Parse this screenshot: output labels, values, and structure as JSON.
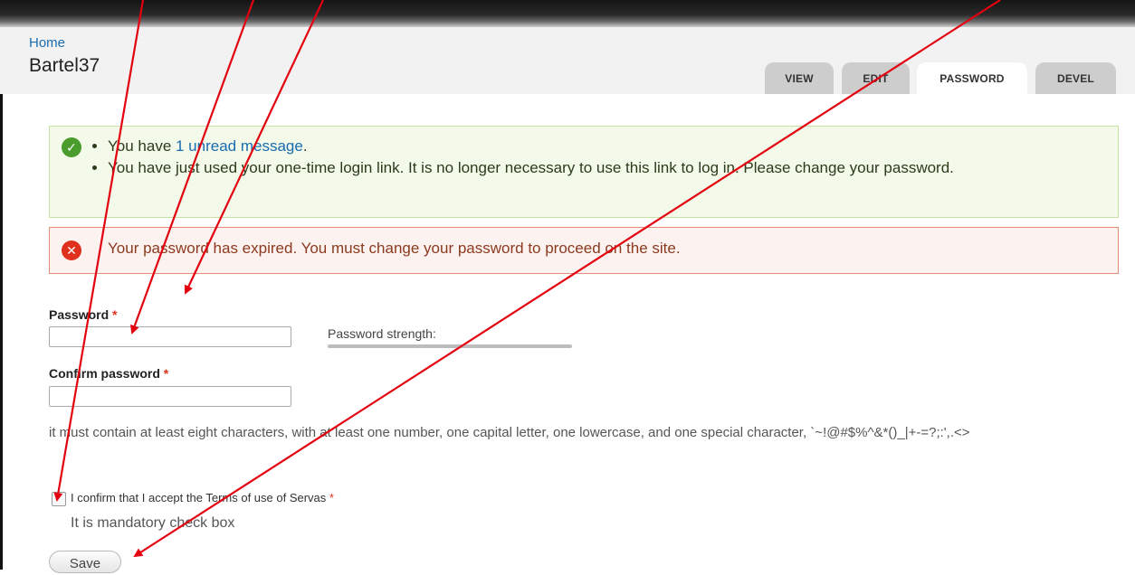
{
  "breadcrumb": "Home",
  "page_title": "Bartel37",
  "tabs": [
    {
      "label": "VIEW",
      "active": false
    },
    {
      "label": "EDIT",
      "active": false
    },
    {
      "label": "PASSWORD",
      "active": true
    },
    {
      "label": "DEVEL",
      "active": false
    }
  ],
  "status_messages": {
    "item1_prefix": "You have ",
    "item1_link": "1 unread message",
    "item1_suffix": ".",
    "item2": "You have just used your one-time login link. It is no longer necessary to use this link to log in. Please change your password.",
    "icon": "check-icon",
    "color": "#4a9c2d"
  },
  "error_message": {
    "text": "Your password has expired. You must change your password to proceed on the site.",
    "icon": "error-x-icon",
    "color": "#e0301e"
  },
  "form": {
    "password_label": "Password",
    "confirm_label": "Confirm password",
    "required_marker": "*",
    "strength_label": "Password strength:",
    "hint": "it must contain at least eight characters, with at least one number, one capital letter, one lowercase, and one special character, `~!@#$%^&*()_|+-=?;:',.<>",
    "terms_label": "I confirm that I accept the Terms of use of Servas",
    "terms_description": "It is mandatory check box",
    "save_label": "Save"
  },
  "annotations": {
    "arrow_color": "#e3000f"
  }
}
